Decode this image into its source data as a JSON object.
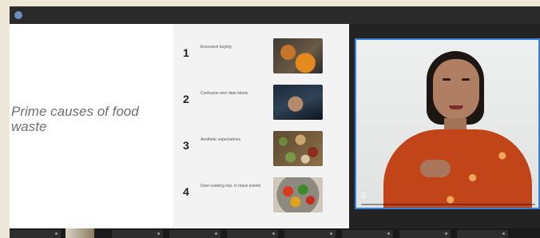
{
  "window": {
    "title": ""
  },
  "slide": {
    "title": "Prime causes of food waste",
    "causes": [
      {
        "number": "1",
        "text": "Excessive buying",
        "thumb": "food-photo-pumpkin"
      },
      {
        "number": "2",
        "text": "Confusion over date labels",
        "thumb": "food-photo-hands"
      },
      {
        "number": "3",
        "text": "Aesthetic expectations",
        "thumb": "food-photo-grains"
      },
      {
        "number": "4",
        "text": "Over-cooking esp. in mass events",
        "thumb": "food-photo-salad"
      }
    ]
  },
  "video": {
    "participant_name": "",
    "border_color": "#3b82d6"
  },
  "strip": {
    "tile_count": 9
  },
  "colors": {
    "page_bg": "#ede7d6",
    "window_bg": "#232323",
    "slide_bg": "#ffffff",
    "accent_blue": "#3b82d6"
  }
}
